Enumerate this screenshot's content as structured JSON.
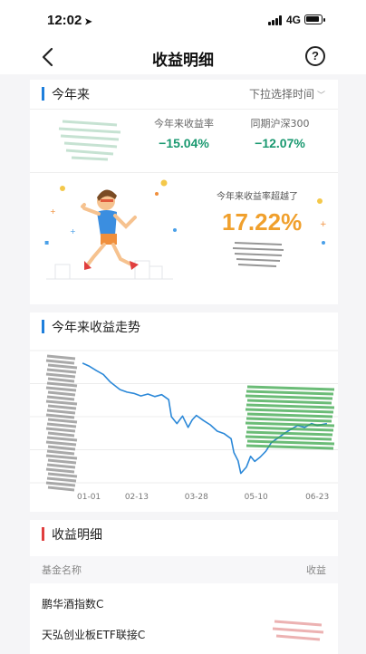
{
  "status_bar": {
    "time": "12:02",
    "network": "4G"
  },
  "nav": {
    "title": "收益明细",
    "help_glyph": "?"
  },
  "ytd": {
    "section_title": "今年来",
    "range_label": "下拉选择时间",
    "accent_color": "#1e7fdc",
    "metrics": [
      {
        "label": "今年来收益率",
        "value": "−15.04%"
      },
      {
        "label": "同期沪深300",
        "value": "−12.07%"
      }
    ],
    "beat_label": "今年来收益率超越了",
    "beat_value": "17.22%"
  },
  "trend": {
    "section_title": "今年来收益走势",
    "accent_color": "#1e7fdc"
  },
  "chart_data": {
    "type": "line",
    "title": "今年来收益走势",
    "x_ticks": [
      "01-01",
      "02-13",
      "03-28",
      "05-10",
      "06-23"
    ],
    "grid": true,
    "series": [
      {
        "color": "#2b88d8",
        "points": [
          [
            "01-05",
            0.0
          ],
          [
            "01-10",
            -0.5
          ],
          [
            "01-15",
            -1.2
          ],
          [
            "01-20",
            -1.8
          ],
          [
            "01-25",
            -3.0
          ],
          [
            "02-01",
            -4.2
          ],
          [
            "02-06",
            -4.6
          ],
          [
            "02-11",
            -4.8
          ],
          [
            "02-16",
            -5.2
          ],
          [
            "02-21",
            -4.9
          ],
          [
            "02-26",
            -5.3
          ],
          [
            "03-03",
            -5.0
          ],
          [
            "03-08",
            -5.8
          ],
          [
            "03-10",
            -8.5
          ],
          [
            "03-14",
            -9.6
          ],
          [
            "03-18",
            -8.4
          ],
          [
            "03-22",
            -10.2
          ],
          [
            "03-25",
            -9.0
          ],
          [
            "03-28",
            -8.3
          ],
          [
            "04-02",
            -9.1
          ],
          [
            "04-07",
            -9.8
          ],
          [
            "04-12",
            -10.8
          ],
          [
            "04-17",
            -11.2
          ],
          [
            "04-22",
            -12.0
          ],
          [
            "04-24",
            -14.2
          ],
          [
            "04-27",
            -15.5
          ],
          [
            "04-29",
            -17.5
          ],
          [
            "05-03",
            -16.5
          ],
          [
            "05-06",
            -14.8
          ],
          [
            "05-09",
            -15.6
          ],
          [
            "05-13",
            -14.9
          ],
          [
            "05-17",
            -14.0
          ],
          [
            "05-21",
            -12.6
          ],
          [
            "05-25",
            -12.0
          ],
          [
            "05-30",
            -11.2
          ],
          [
            "06-04",
            -10.5
          ],
          [
            "06-09",
            -9.9
          ],
          [
            "06-14",
            -10.2
          ],
          [
            "06-19",
            -9.6
          ],
          [
            "06-23",
            -9.9
          ],
          [
            "06-30",
            -9.6
          ]
        ]
      }
    ]
  },
  "detail": {
    "section_title": "收益明细",
    "accent_color": "#e03e3e",
    "col_name": "基金名称",
    "col_profit": "收益",
    "funds": [
      {
        "name": "鹏华酒指数C"
      },
      {
        "name": "天弘创业板ETF联接C"
      }
    ]
  }
}
